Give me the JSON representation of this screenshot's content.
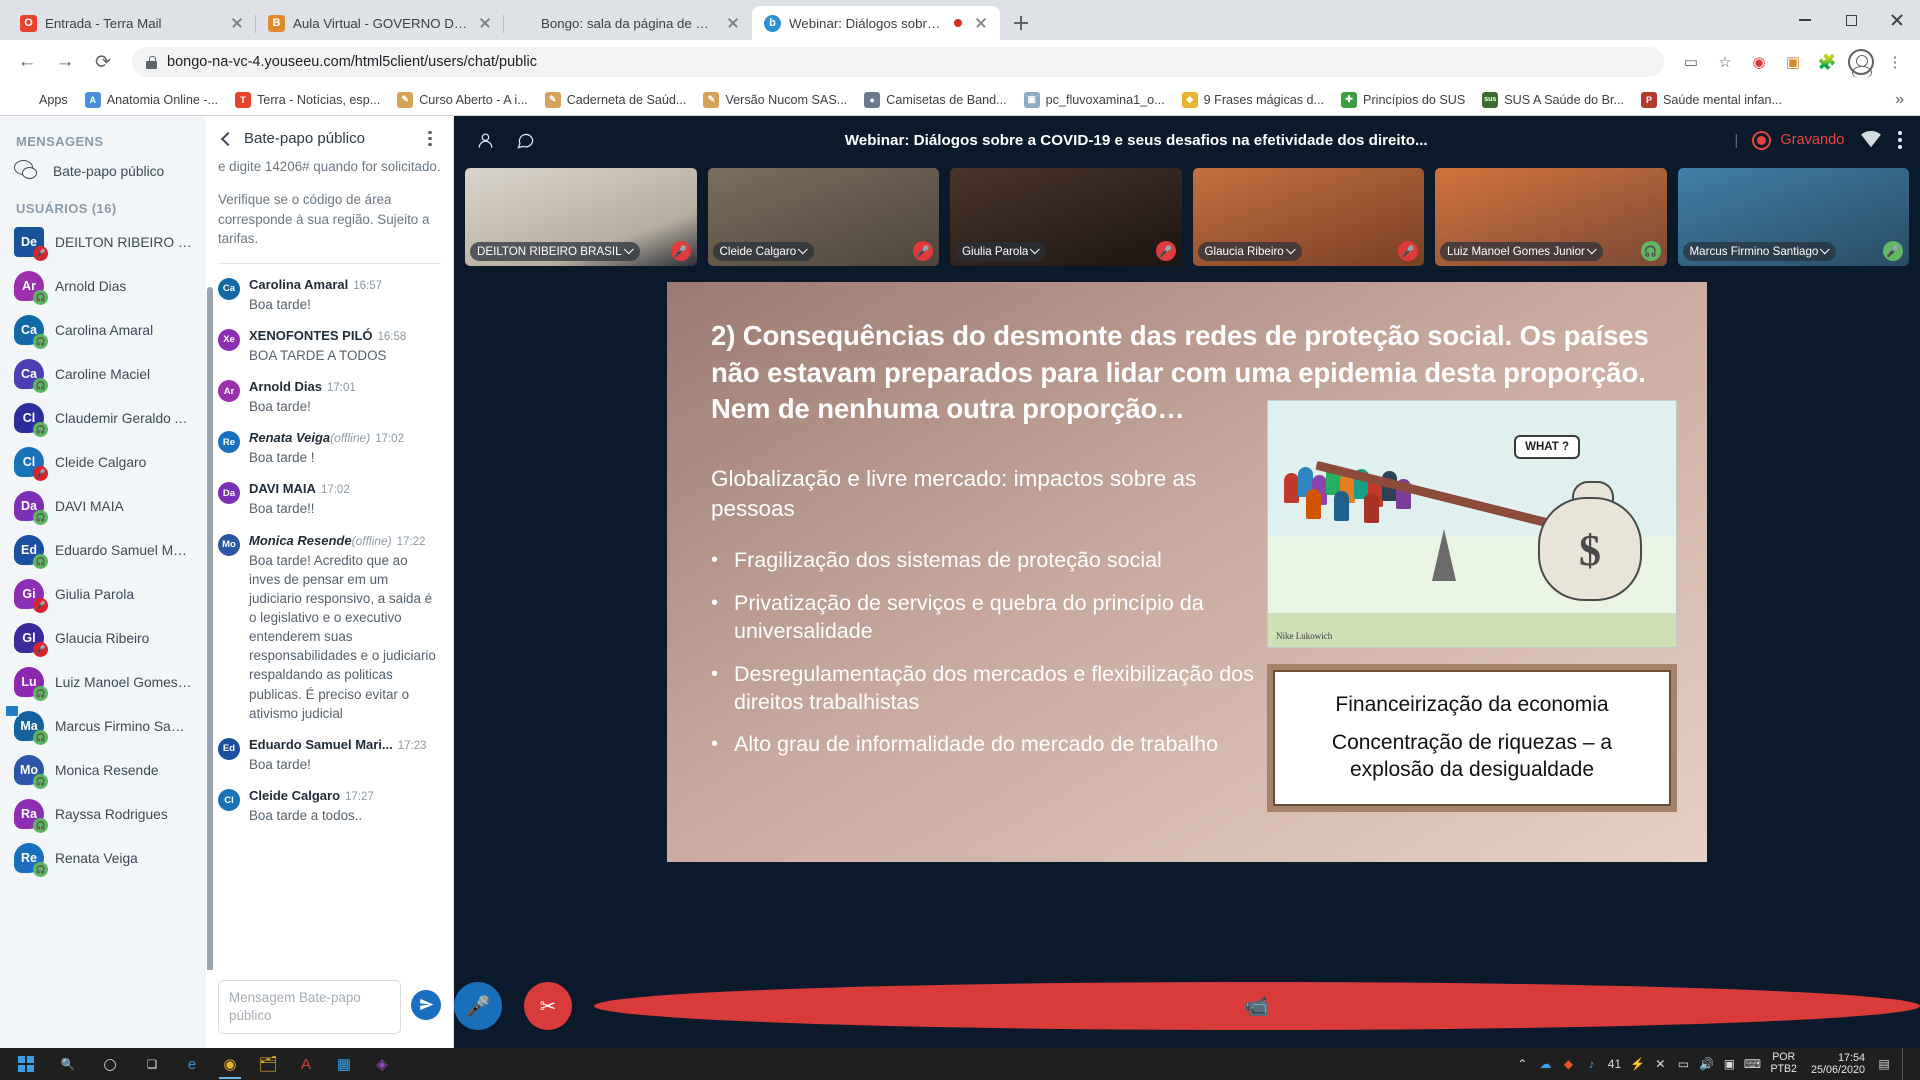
{
  "browser": {
    "tabs": [
      {
        "title": "Entrada - Terra Mail",
        "favicon": "terra-icon",
        "color": "#e8412c",
        "active": false
      },
      {
        "title": "Aula Virtual - GOVERNO DE RISC",
        "favicon": "bitcoin-icon",
        "color": "#e08a2e",
        "active": false
      },
      {
        "title": "Bongo: sala da página de encont",
        "favicon": "blank-icon",
        "color": "#c7ccd1",
        "active": false
      },
      {
        "title": "Webinar: Diálogos sobre a C",
        "favicon": "bongo-icon",
        "color": "#2b8fd4",
        "active": true,
        "recording": true
      }
    ],
    "new_tab_label": "+",
    "window_controls": {
      "minimize": "minimize-icon",
      "maximize": "maximize-icon",
      "close": "close-icon"
    },
    "nav": {
      "back": "←",
      "forward": "→",
      "reload": "⟳"
    },
    "address": {
      "url": "bongo-na-vc-4.youseeu.com/html5client/users/chat/public",
      "lock": "lock-icon"
    },
    "toolbar_icons": [
      "cast-icon",
      "star-icon",
      "opera-extension-icon",
      "lock-extension-icon",
      "puzzle-extension-icon",
      "profile-icon",
      "chrome-menu-icon"
    ],
    "bookmarks_label": "Apps",
    "bookmarks": [
      {
        "label": "Anatomia Online -...",
        "color": "#4a90d9",
        "glyph": "A"
      },
      {
        "label": "Terra - Notícias, esp...",
        "color": "#e8412c",
        "glyph": "T"
      },
      {
        "label": "Curso Aberto - A i...",
        "color": "#d8a15a",
        "glyph": "✎"
      },
      {
        "label": "Caderneta de Saúd...",
        "color": "#d8a15a",
        "glyph": "✎"
      },
      {
        "label": "Versão Nucom SAS...",
        "color": "#d8a15a",
        "glyph": "✎"
      },
      {
        "label": "Camisetas de Band...",
        "color": "#6b7a8f",
        "glyph": "●"
      },
      {
        "label": "pc_fluvoxamina1_o...",
        "color": "#8ea9c4",
        "glyph": "▣"
      },
      {
        "label": "9 Frases mágicas d...",
        "color": "#e8b32c",
        "glyph": "◆"
      },
      {
        "label": "Princípios do SUS",
        "color": "#3d9e3d",
        "glyph": "✚"
      },
      {
        "label": "SUS A Saúde do Br...",
        "color": "#3c6e2e",
        "glyph": "sus"
      },
      {
        "label": "Saúde mental infan...",
        "color": "#b03a2e",
        "glyph": "P"
      }
    ],
    "bookmarks_overflow": "»"
  },
  "nav_panel": {
    "messages_header": "MENSAGENS",
    "public_chat_label": "Bate-papo público",
    "users_header": "USUÁRIOS (16)",
    "users": [
      {
        "name": "DEILTON RIBEIRO BRASI...",
        "initials": "De",
        "color": "#17529b",
        "shape": "square",
        "status": "mic-off"
      },
      {
        "name": "Arnold Dias",
        "initials": "Ar",
        "color": "#9b2fae",
        "status": "listening"
      },
      {
        "name": "Carolina Amaral",
        "initials": "Ca",
        "color": "#1169a8",
        "status": "listening"
      },
      {
        "name": "Caroline Maciel",
        "initials": "Ca",
        "color": "#4a3fb5",
        "status": "listening"
      },
      {
        "name": "Claudemir Geraldo Ana...",
        "initials": "Cl",
        "color": "#2c2f9b",
        "status": "listening"
      },
      {
        "name": "Cleide Calgaro",
        "initials": "Cl",
        "color": "#1774b8",
        "status": "mic-off"
      },
      {
        "name": "DAVI MAIA",
        "initials": "Da",
        "color": "#7b30b5",
        "status": "listening"
      },
      {
        "name": "Eduardo Samuel Marinho",
        "initials": "Ed",
        "color": "#1b4fa0",
        "status": "listening"
      },
      {
        "name": "Giulia Parola",
        "initials": "Gi",
        "color": "#8d2fb5",
        "status": "mic-off"
      },
      {
        "name": "Glaucia Ribeiro",
        "initials": "Gl",
        "color": "#3b2a9b",
        "status": "mic-off"
      },
      {
        "name": "Luiz Manoel Gomes Juni...",
        "initials": "Lu",
        "color": "#8d27b0",
        "status": "listening"
      },
      {
        "name": "Marcus Firmino Santiago",
        "initials": "Ma",
        "color": "#14639e",
        "status": "presenter"
      },
      {
        "name": "Monica Resende",
        "initials": "Mo",
        "color": "#2d56a8",
        "status": "listening"
      },
      {
        "name": "Rayssa Rodrigues",
        "initials": "Ra",
        "color": "#8d2fb5",
        "status": "listening"
      },
      {
        "name": "Renata Veiga",
        "initials": "Re",
        "color": "#1b6fbf",
        "status": "listening"
      }
    ]
  },
  "chat": {
    "back_icon": "chevron-left-icon",
    "title": "Bate-papo público",
    "options_icon": "kebab-menu-icon",
    "system_messages": [
      "e digite 14206# quando for solicitado.",
      "Verifique se o código de área corresponde à sua região. Sujeito a tarifas."
    ],
    "messages": [
      {
        "author": "Carolina Amaral",
        "initials": "Ca",
        "color": "#1169a8",
        "time": "16:57",
        "offline": "",
        "text": "Boa tarde!"
      },
      {
        "author": "XENOFONTES PILÓ",
        "initials": "Xe",
        "color": "#8d2fb5",
        "time": "16:58",
        "offline": "",
        "text": "BOA TARDE A TODOS"
      },
      {
        "author": "Arnold Dias",
        "initials": "Ar",
        "color": "#9b2fae",
        "time": "17:01",
        "offline": "",
        "text": "Boa tarde!"
      },
      {
        "author": "Renata Veiga",
        "initials": "Re",
        "color": "#1b6fbf",
        "time": "17:02",
        "offline": "(offline)",
        "text": "Boa tarde !"
      },
      {
        "author": "DAVI MAIA",
        "initials": "Da",
        "color": "#7b30b5",
        "time": "17:02",
        "offline": "",
        "text": "Boa tarde!!"
      },
      {
        "author": "Monica Resende",
        "initials": "Mo",
        "color": "#2d56a8",
        "time": "17:22",
        "offline": "(offline)",
        "text": "Boa tarde! Acredito que ao inves de pensar em um judiciario responsivo, a saida é o legislativo e o executivo entenderem suas responsabilidades e o judiciario respaldando as politicas publicas. É preciso evitar o ativismo judicial"
      },
      {
        "author": "Eduardo Samuel Mari...",
        "initials": "Ed",
        "color": "#1b4fa0",
        "time": "17:23",
        "offline": "",
        "text": "Boa tarde!"
      },
      {
        "author": "Cleide Calgaro",
        "initials": "Cl",
        "color": "#1774b8",
        "time": "17:27",
        "offline": "",
        "text": "Boa tarde a todos.."
      }
    ],
    "input_placeholder": "Mensagem Bate-papo público",
    "send_icon": "send-icon"
  },
  "meeting": {
    "users_icon": "users-icon",
    "chat_icon": "chat-bubble-icon",
    "title": "Webinar: Diálogos sobre a COVID-19 e seus desafios na efetividade dos direito...",
    "divider": "|",
    "recording_label": "Gravando",
    "recording_icon": "record-icon",
    "connection_icon": "wifi-icon",
    "options_icon": "kebab-menu-icon",
    "cameras": [
      {
        "name": "DEILTON RIBEIRO BRASIL",
        "status": "mic-off",
        "bg": "#cfcac3"
      },
      {
        "name": "Cleide Calgaro",
        "status": "mic-off",
        "bg": "#6e6256"
      },
      {
        "name": "Giulia Parola",
        "status": "mic-off",
        "bg": "#3a2a24"
      },
      {
        "name": "Glaucia Ribeiro",
        "status": "mic-off",
        "bg": "#b4633f"
      },
      {
        "name": "Luiz Manoel Gomes Junior",
        "status": "listening",
        "bg": "#8a4a3a"
      },
      {
        "name": "Marcus Firmino Santiago",
        "status": "mic-on",
        "bg": "#2d6b8f"
      }
    ],
    "controls": [
      {
        "name": "microphone-button",
        "icon": "🎤",
        "kind": "mic"
      },
      {
        "name": "leave-audio-button",
        "icon": "✂",
        "kind": "leave"
      },
      {
        "name": "camera-button",
        "icon": "📹",
        "kind": "cam"
      }
    ]
  },
  "slide": {
    "heading": "2) Consequências do desmonte das redes de proteção social. Os países não estavam preparados para lidar com uma epidemia desta proporção. Nem de nenhuma outra proporção…",
    "subheading": "Globalização e livre mercado: impactos sobre as pessoas",
    "bullets": [
      "Fragilização dos sistemas de proteção social",
      "Privatização de serviços e quebra do princípio da universalidade",
      "Desregulamentação dos mercados e flexibilização dos direitos trabalhistas",
      "Alto grau de informalidade do mercado de trabalho"
    ],
    "cartoon": {
      "speech_bubble": "WHAT ?",
      "signature": "Nike Lukowich",
      "money_symbol": "$"
    },
    "callout": {
      "line1": "Financeirização da economia",
      "line2": "Concentração de riquezas – a explosão da desigualdade"
    }
  },
  "taskbar": {
    "start_icon": "windows-start-icon",
    "search_icon": "search-icon",
    "cortana_icon": "cortana-icon",
    "taskview_icon": "task-view-icon",
    "apps": [
      {
        "name": "edge-icon",
        "glyph": "e",
        "color": "#2f8ed6",
        "active": false
      },
      {
        "name": "chrome-icon",
        "glyph": "◉",
        "color": "#e8b32c",
        "active": true
      },
      {
        "name": "file-explorer-icon",
        "glyph": "🗂",
        "color": "#e8b32c",
        "active": false
      },
      {
        "name": "acrobat-icon",
        "glyph": "A",
        "color": "#d93b3b",
        "active": false
      },
      {
        "name": "app5-icon",
        "glyph": "▦",
        "color": "#3aa0e8",
        "active": false
      },
      {
        "name": "app6-icon",
        "glyph": "◈",
        "color": "#8d4ab5",
        "active": false
      }
    ],
    "tray_icons": [
      "chevron-up-icon",
      "onedrive-icon",
      "antivirus-icon",
      "music-icon"
    ],
    "notification_count": "41",
    "more_tray": [
      "usb-icon",
      "bluetooth-icon",
      "screen-icon",
      "volume-icon",
      "network-icon",
      "keyboard-icon"
    ],
    "language_line1": "POR",
    "language_line2": "PTB2",
    "clock_time": "17:54",
    "clock_date": "25/06/2020",
    "notifications_icon": "action-center-icon"
  }
}
